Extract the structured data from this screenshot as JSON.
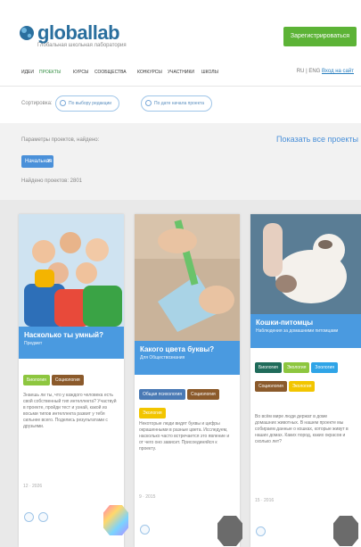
{
  "header": {
    "logo_text": "globallab",
    "tagline": "Глобальная школьная лаборатория",
    "cta_label": "Зарегистрироваться"
  },
  "nav": {
    "items": [
      "Идеи",
      "Проекты",
      "Курсы",
      "Сообщества",
      "Конкурсы",
      "Участники",
      "Школы"
    ],
    "active_index": 1,
    "right_lang": "RU | ENG",
    "right_link": "Вход на сайт"
  },
  "sort": {
    "label": "Сортировка:",
    "options": [
      "По выбору редакции",
      "По дате начала проекта"
    ]
  },
  "filter": {
    "label": "Параметры проектов, найдено:",
    "show_all": "Показать все проекты",
    "chip_label": "Начальная",
    "found_text": "Найдено проектов: 2801"
  },
  "cards": [
    {
      "title": "Насколько ты умный?",
      "subtitle": "Предмет",
      "tags": [
        {
          "label": "Биология",
          "color": "#8dc63f"
        },
        {
          "label": "Социология",
          "color": "#8b5a2b"
        }
      ],
      "description": "Знаешь ли ты, что у каждого человека есть свой собственный тип интеллекта? Участвуй в проекте, пройди тест и узнай, какой из восьми типов интеллекта развит у тебя сильнее всего. Поделись результатами с друзьями.",
      "meta": "12 · 2026"
    },
    {
      "title": "Какого цвета буквы?",
      "subtitle": "Для Обществознания",
      "tags": [
        {
          "label": "Общая психология",
          "color": "#4a7ab5"
        },
        {
          "label": "Социология",
          "color": "#8b5a2b"
        },
        {
          "label": "Экология",
          "color": "#f2c500"
        }
      ],
      "description": "Некоторые люди видят буквы и цифры окрашенными в разные цвета. Исследуем, насколько часто встречается это явление и от чего оно зависит. Присоединяйся к проекту.",
      "meta": "9 · 2015"
    },
    {
      "title": "Кошки-питомцы",
      "subtitle": "Наблюдения за домашними питомцами",
      "tags": [
        {
          "label": "Биология",
          "color": "#1f6b5a"
        },
        {
          "label": "Экология",
          "color": "#8dc63f"
        },
        {
          "label": "Зоология",
          "color": "#2fa4e7"
        },
        {
          "label": "Социология",
          "color": "#8b5a2b"
        },
        {
          "label": "Экология",
          "color": "#f2c500"
        }
      ],
      "description": "Во всём мире люди держат в доме домашних животных. В нашем проекте мы собираем данные о кошках, которые живут в наших домах. Каких пород, каких окрасов и сколько лет?",
      "meta": "15 · 2016"
    }
  ]
}
